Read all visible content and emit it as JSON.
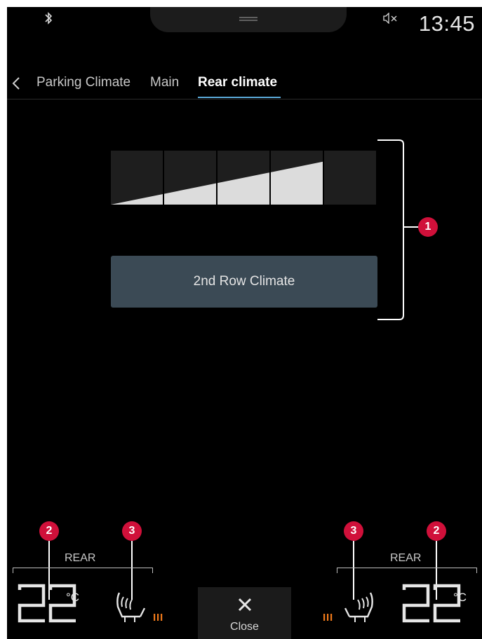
{
  "status": {
    "time": "13:45",
    "icons": [
      "bluetooth-icon",
      "mute-icon"
    ]
  },
  "tabs": {
    "back_icon": "chevron-left-icon",
    "items": [
      {
        "label": "Parking Climate",
        "active": false
      },
      {
        "label": "Main",
        "active": false
      },
      {
        "label": "Rear climate",
        "active": true
      }
    ]
  },
  "fan": {
    "levels": 5,
    "current_level": 4,
    "icon": "fan-level-ramp"
  },
  "second_row": {
    "label": "2nd Row Climate"
  },
  "callouts": {
    "one": "1",
    "two": "2",
    "three": "3"
  },
  "left": {
    "zone_label": "REAR",
    "temperature": "22",
    "unit": "°C",
    "seat_heat_icon": "seat-heat-icon",
    "heat_level": 3
  },
  "right": {
    "zone_label": "REAR",
    "temperature": "22",
    "unit": "°C",
    "seat_heat_icon": "seat-heat-icon",
    "heat_level": 3
  },
  "close": {
    "label": "Close",
    "icon": "close-icon"
  },
  "colors": {
    "accent_underline": "#5aa9d8",
    "button_bg": "#3b4a55",
    "callout": "#d0103a",
    "heat_active": "#f07a1a"
  }
}
